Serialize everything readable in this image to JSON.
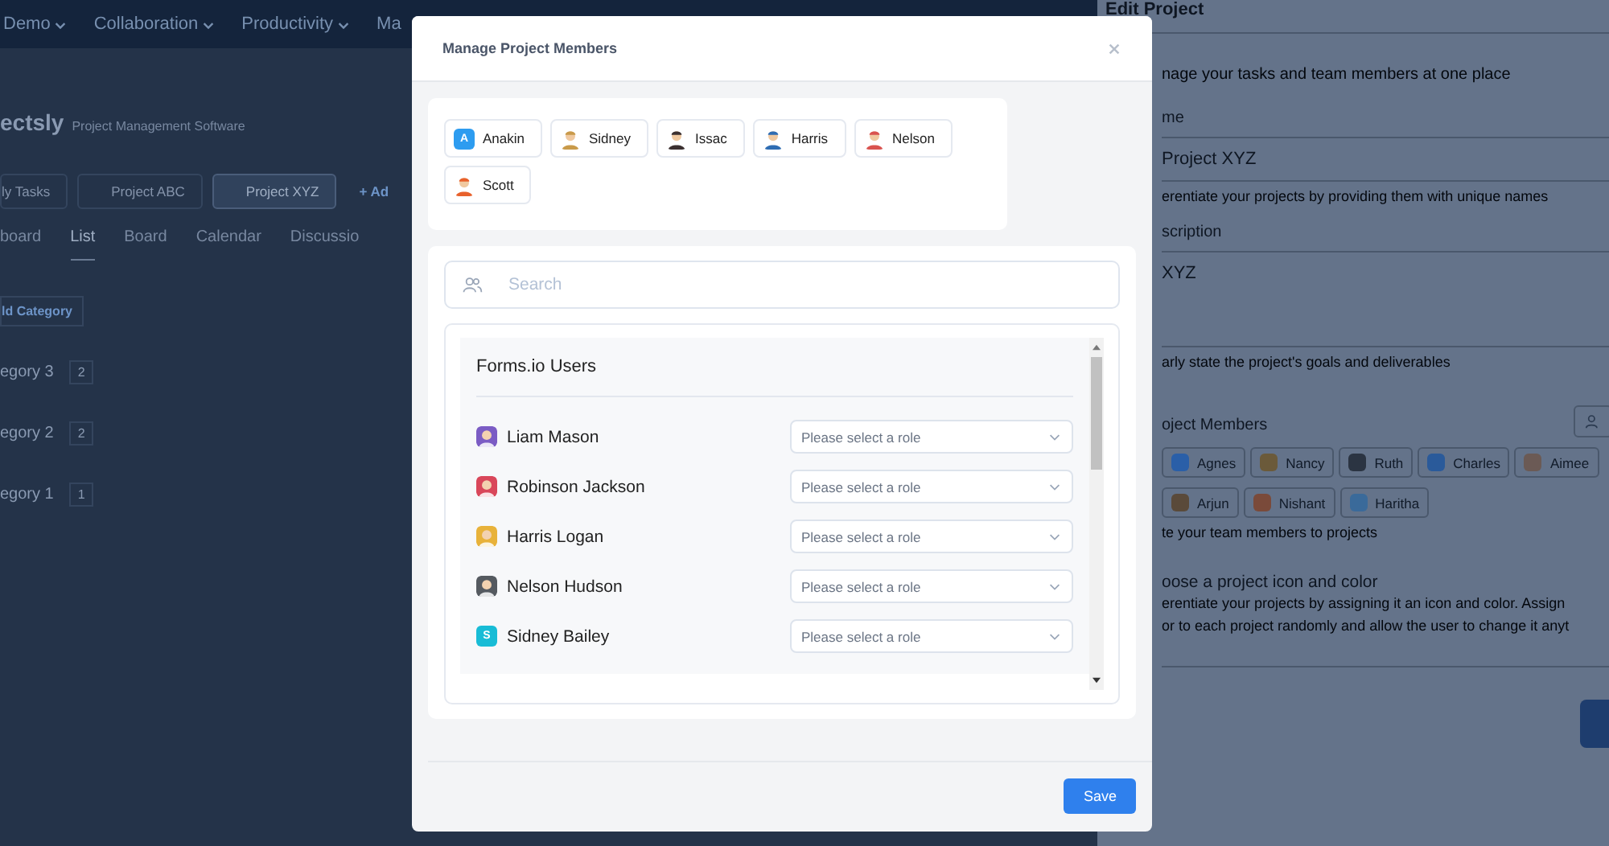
{
  "nav": {
    "items": [
      {
        "label": "Demo",
        "caret": true
      },
      {
        "label": "Collaboration",
        "caret": true
      },
      {
        "label": "Productivity",
        "caret": true
      },
      {
        "label": "Ma",
        "caret": false
      }
    ]
  },
  "app": {
    "brand": "ectsly",
    "subtitle": "Project Management Software",
    "projects": [
      {
        "label": "ly Tasks",
        "selected": false
      },
      {
        "label": "Project ABC",
        "selected": false
      },
      {
        "label": "Project XYZ",
        "selected": true
      }
    ],
    "add_project": "+ Ad",
    "views": [
      {
        "label": "board",
        "selected": false
      },
      {
        "label": "List",
        "selected": true
      },
      {
        "label": "Board",
        "selected": false
      },
      {
        "label": "Calendar",
        "selected": false
      },
      {
        "label": "Discussio",
        "selected": false
      }
    ],
    "add_category": "ld Category",
    "categories": [
      {
        "name": "egory 3",
        "count": "2"
      },
      {
        "name": "egory 2",
        "count": "2"
      },
      {
        "name": "egory 1",
        "count": "1"
      }
    ]
  },
  "edit_panel": {
    "title": "Edit Project",
    "intro": "nage your tasks and team members at one place",
    "name_label": "me",
    "name_value": "Project XYZ",
    "name_help": "erentiate your projects by providing them with unique names",
    "description_label": "scription",
    "description_value": "XYZ",
    "description_help": "arly state the project's goals and deliverables",
    "members_label": "oject Members",
    "members": [
      [
        {
          "name": "Agnes",
          "color": "#2a5fa8"
        },
        {
          "name": "Nancy",
          "color": "#6b5a3a"
        },
        {
          "name": "Ruth",
          "color": "#2b3442"
        },
        {
          "name": "Charles",
          "color": "#2a5a9a"
        },
        {
          "name": "Aimee",
          "color": "#6b5a55"
        }
      ],
      [
        {
          "name": "Arjun",
          "color": "#5a4a3a"
        },
        {
          "name": "Nishant",
          "color": "#7a4a3a"
        },
        {
          "name": "Haritha",
          "color": "#3a6a9a"
        }
      ]
    ],
    "members_help": "te your team members to projects",
    "icon_label": "oose a project icon and color",
    "icon_help": [
      "erentiate your projects by assigning it an icon and color. Assign",
      "or to each project randomly and allow the user to change it anyt"
    ]
  },
  "modal": {
    "title": "Manage Project Members",
    "selected_members": [
      {
        "name": "Anakin",
        "avatar": {
          "kind": "letter",
          "letter": "A",
          "color": "#2d9cf0"
        }
      },
      {
        "name": "Sidney",
        "avatar": {
          "kind": "figure",
          "color": "#c99a4a"
        }
      },
      {
        "name": "Issac",
        "avatar": {
          "kind": "figure",
          "color": "#3b3030"
        }
      },
      {
        "name": "Harris",
        "avatar": {
          "kind": "figure",
          "color": "#2f6db3"
        }
      },
      {
        "name": "Nelson",
        "avatar": {
          "kind": "figure",
          "color": "#d9534f"
        }
      },
      {
        "name": "Scott",
        "avatar": {
          "kind": "figure",
          "color": "#e8612c"
        }
      }
    ],
    "search": {
      "placeholder": "Search"
    },
    "group_title": "Forms.io Users",
    "users": [
      {
        "name": "Liam Mason",
        "avatar": {
          "kind": "figure",
          "color": "#7b5cc4"
        },
        "role_placeholder": "Please select a role"
      },
      {
        "name": "Robinson Jackson",
        "avatar": {
          "kind": "figure",
          "color": "#d9475a"
        },
        "role_placeholder": "Please select a role"
      },
      {
        "name": "Harris Logan",
        "avatar": {
          "kind": "figure",
          "color": "#e8b23a"
        },
        "role_placeholder": "Please select a role"
      },
      {
        "name": "Nelson Hudson",
        "avatar": {
          "kind": "figure",
          "color": "#555a60"
        },
        "role_placeholder": "Please select a role"
      },
      {
        "name": "Sidney Bailey",
        "avatar": {
          "kind": "letter",
          "letter": "S",
          "color": "#18bcd6"
        },
        "role_placeholder": "Please select a role"
      }
    ],
    "save": "Save"
  }
}
